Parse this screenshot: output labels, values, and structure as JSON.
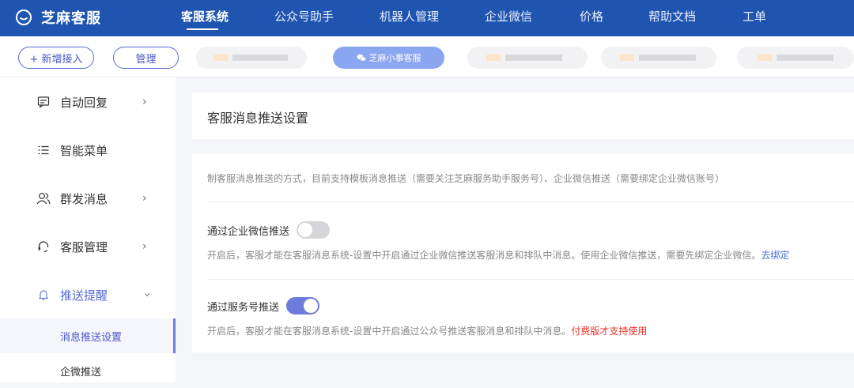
{
  "app": {
    "brand": "芝麻客服"
  },
  "nav": {
    "items": [
      {
        "label": "客服系统",
        "active": true
      },
      {
        "label": "公众号助手",
        "active": false
      },
      {
        "label": "机器人管理",
        "active": false
      },
      {
        "label": "企业微信",
        "active": false
      },
      {
        "label": "价格",
        "active": false
      },
      {
        "label": "帮助文档",
        "active": false
      },
      {
        "label": "工单",
        "active": false
      }
    ]
  },
  "accounts": {
    "add_label": "+ 新增接入",
    "manage_label": "管理",
    "current_account": "芝麻小事客服"
  },
  "sidebar": {
    "items": [
      {
        "label": "自动回复",
        "icon": "message-square-icon",
        "has_chevron": true
      },
      {
        "label": "智能菜单",
        "icon": "list-icon",
        "has_chevron": false
      },
      {
        "label": "群发消息",
        "icon": "users-icon",
        "has_chevron": true
      },
      {
        "label": "客服管理",
        "icon": "headset-icon",
        "has_chevron": true
      },
      {
        "label": "推送提醒",
        "icon": "bell-icon",
        "has_chevron": true,
        "expanded": true
      }
    ],
    "sub_items": [
      {
        "label": "消息推送设置",
        "active": true
      },
      {
        "label": "企微推送",
        "active": false
      }
    ]
  },
  "main": {
    "title": "客服消息推送设置",
    "description": "制客服消息推送的方式，目前支持模板消息推送（需要关注芝麻服务助手服务号）、企业微信推送（需要绑定企业微信账号）",
    "options": [
      {
        "title": "通过企业微信推送",
        "enabled": false,
        "desc": "开启后，客服才能在客服消息系统-设置中开启通过企业微信推送客服消息和排队中消息。使用企业微信推送，需要先绑定企业微信。",
        "link": "去绑定"
      },
      {
        "title": "通过服务号推送",
        "enabled": true,
        "desc": "开启后，客服才能在客服消息系统-设置中开启通过公众号推送客服消息和排队中消息。",
        "warning": "付费版才支持使用"
      }
    ]
  },
  "colors": {
    "topbar": "#1f55b0",
    "accent": "#6e7cdb",
    "link": "#4a6fd8",
    "warning": "#e8312b"
  }
}
